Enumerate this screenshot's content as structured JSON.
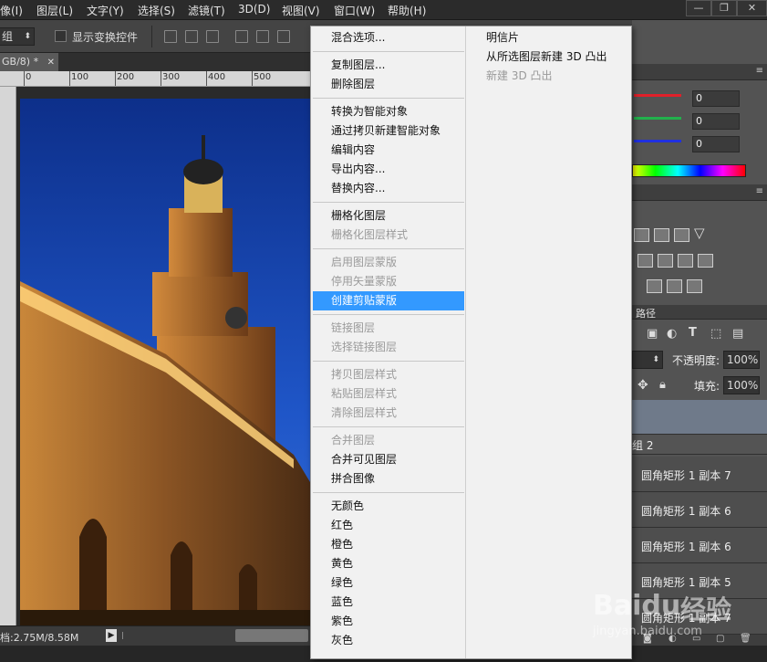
{
  "menubar": {
    "items": [
      "像(I)",
      "图层(L)",
      "文字(Y)",
      "选择(S)",
      "滤镜(T)",
      "3D(D)",
      "视图(V)",
      "窗口(W)",
      "帮助(H)"
    ],
    "window_buttons": [
      "—",
      "❐",
      "✕"
    ]
  },
  "options_bar": {
    "dropdown_value": "组",
    "show_transform_label": "显示变换控件"
  },
  "document": {
    "tab_label": "GB/8) *",
    "tab_close": "✕",
    "ruler_ticks": [
      "0",
      "100",
      "200",
      "300",
      "400",
      "500"
    ]
  },
  "status": {
    "doc_size": "档:2.75M/8.58M",
    "arrow": "▶"
  },
  "context_menu": {
    "col1_groups": [
      [
        {
          "label": "混合选项...",
          "enabled": true
        }
      ],
      [
        {
          "label": "复制图层...",
          "enabled": true
        },
        {
          "label": "删除图层",
          "enabled": true
        }
      ],
      [
        {
          "label": "转换为智能对象",
          "enabled": true
        },
        {
          "label": "通过拷贝新建智能对象",
          "enabled": true
        },
        {
          "label": "编辑内容",
          "enabled": true
        },
        {
          "label": "导出内容...",
          "enabled": true
        },
        {
          "label": "替换内容...",
          "enabled": true
        }
      ],
      [
        {
          "label": "栅格化图层",
          "enabled": true
        },
        {
          "label": "栅格化图层样式",
          "enabled": false
        }
      ],
      [
        {
          "label": "启用图层蒙版",
          "enabled": false
        },
        {
          "label": "停用矢量蒙版",
          "enabled": false
        },
        {
          "label": "创建剪贴蒙版",
          "enabled": true,
          "selected": true
        }
      ],
      [
        {
          "label": "链接图层",
          "enabled": false
        },
        {
          "label": "选择链接图层",
          "enabled": false
        }
      ],
      [
        {
          "label": "拷贝图层样式",
          "enabled": false
        },
        {
          "label": "粘贴图层样式",
          "enabled": false
        },
        {
          "label": "清除图层样式",
          "enabled": false
        }
      ],
      [
        {
          "label": "合并图层",
          "enabled": false
        },
        {
          "label": "合并可见图层",
          "enabled": true
        },
        {
          "label": "拼合图像",
          "enabled": true
        }
      ],
      [
        {
          "label": "无颜色",
          "enabled": true
        },
        {
          "label": "红色",
          "enabled": true
        },
        {
          "label": "橙色",
          "enabled": true
        },
        {
          "label": "黄色",
          "enabled": true
        },
        {
          "label": "绿色",
          "enabled": true
        },
        {
          "label": "蓝色",
          "enabled": true
        },
        {
          "label": "紫色",
          "enabled": true
        },
        {
          "label": "灰色",
          "enabled": true
        }
      ]
    ],
    "col2_items": [
      {
        "label": "明信片",
        "enabled": true
      },
      {
        "label": "从所选图层新建 3D 凸出",
        "enabled": true
      },
      {
        "label": "新建 3D 凸出",
        "enabled": false
      }
    ]
  },
  "color_panel": {
    "values": [
      "0",
      "0",
      "0"
    ],
    "colors": [
      "#e0202a",
      "#22b14c",
      "#2030e0"
    ]
  },
  "layers_panel": {
    "tab_label": "路径",
    "opacity_label": "不透明度:",
    "opacity_value": "100%",
    "fill_label": "填充:",
    "fill_value": "100%",
    "group_label": "组 2",
    "layers": [
      "圆角矩形 1 副本 7",
      "圆角矩形 1 副本 6",
      "圆角矩形 1 副本 6",
      "圆角矩形 1 副本 5",
      "圆角矩形 1 副本 7"
    ]
  },
  "watermark": {
    "brand": "Baidu",
    "brand_cn": "经验",
    "url": "jingyan.baidu.com"
  }
}
